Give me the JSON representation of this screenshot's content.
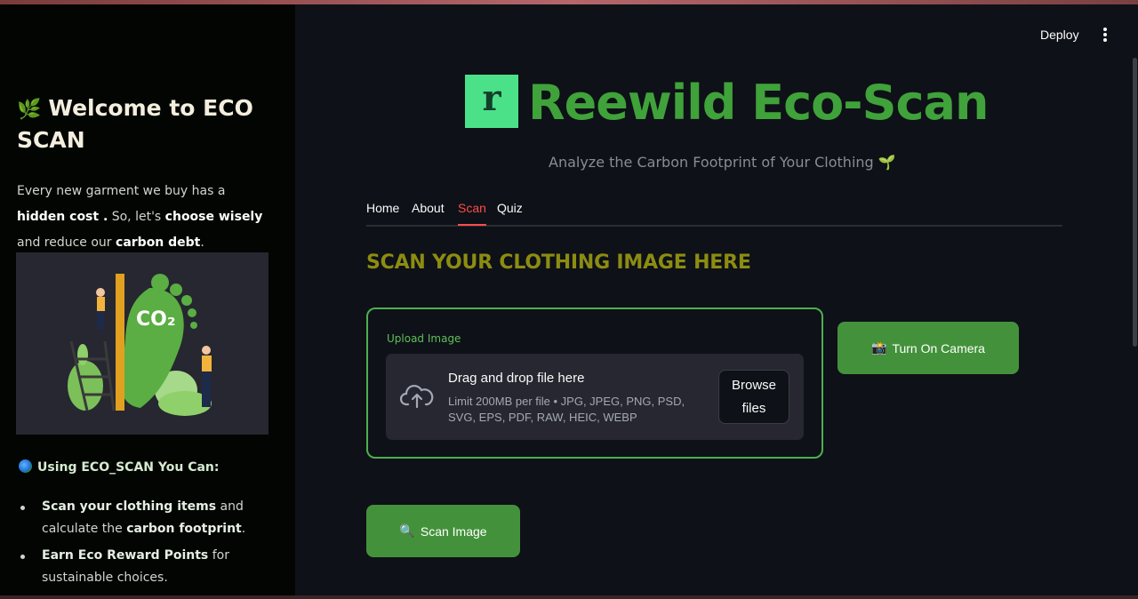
{
  "header": {
    "deploy_label": "Deploy",
    "menu_icon": "kebab-menu-icon"
  },
  "sidebar": {
    "title_icon": "🌿",
    "title": "Welcome to ECO SCAN",
    "intro_1": "Every new garment we buy has a ",
    "intro_hidden_cost": "hidden cost .",
    "intro_2": " So, let's ",
    "intro_choose": "choose wisely",
    "intro_3": " and reduce our ",
    "intro_carbon": "carbon debt",
    "intro_4": ".",
    "image_text": "CO₂",
    "using_label": "Using ECO_SCAN You Can:",
    "items": [
      {
        "bold": "Scan your clothing items",
        "rest_a": " and calculate the ",
        "bold2": "carbon footprint",
        "rest_b": "."
      },
      {
        "bold": "Earn Eco Reward Points",
        "rest_a": " for sustainable choices.",
        "bold2": "",
        "rest_b": ""
      }
    ]
  },
  "brand": {
    "logo_letter": "r",
    "title": "Reewild Eco-Scan",
    "subtitle": "Analyze the Carbon Footprint of Your Clothing 🌱"
  },
  "tabs": [
    {
      "label": "Home",
      "active": false
    },
    {
      "label": "About",
      "active": false
    },
    {
      "label": "Scan",
      "active": true
    },
    {
      "label": "Quiz",
      "active": false
    }
  ],
  "scan": {
    "heading": "SCAN YOUR CLOTHING IMAGE HERE",
    "upload_label": "Upload Image",
    "drop_title": "Drag and drop file here",
    "drop_limit": "Limit 200MB per file • JPG, JPEG, PNG, PSD, SVG, EPS, PDF, RAW, HEIC, WEBP",
    "browse_label": "Browse files",
    "camera_icon": "📸",
    "camera_label": "Turn On Camera",
    "scan_icon": "🔍",
    "scan_label": "Scan Image"
  },
  "colors": {
    "accent_green": "#43923b",
    "brand_green": "#40a23a",
    "active_tab": "#ff4b4b",
    "heading_olive": "#8c8c12"
  }
}
